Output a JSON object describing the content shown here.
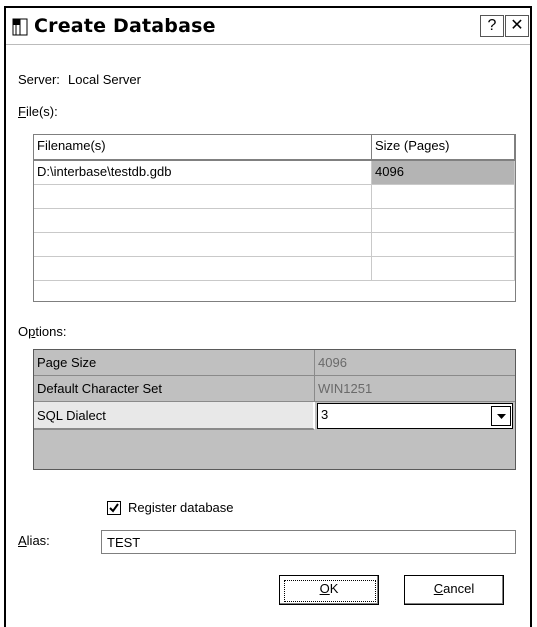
{
  "dialog": {
    "title": "Create Database",
    "help_glyph": "?",
    "close_glyph": "✕"
  },
  "server": {
    "label": "Server:",
    "value": "Local Server"
  },
  "files": {
    "label": "File(s):",
    "columns": [
      "Filename(s)",
      "Size (Pages)"
    ],
    "rows": [
      [
        "D:\\interbase\\testdb.gdb",
        "4096"
      ],
      [
        "",
        ""
      ],
      [
        "",
        ""
      ],
      [
        "",
        ""
      ],
      [
        "",
        ""
      ]
    ]
  },
  "options": {
    "label": "Options:",
    "rows": [
      {
        "name": "Page Size",
        "value": "4096"
      },
      {
        "name": "Default Character Set",
        "value": "WIN1251"
      },
      {
        "name": "SQL Dialect",
        "value": "3"
      }
    ]
  },
  "register": {
    "label": "Register database",
    "checked": true
  },
  "alias": {
    "label": "Alias:",
    "value": "TEST"
  },
  "buttons": {
    "ok": "OK",
    "cancel": "Cancel"
  },
  "colors": {
    "grey_row": "#c0c0c0",
    "selected_cell": "#b4b4b4",
    "border": "#7f7f7f"
  }
}
